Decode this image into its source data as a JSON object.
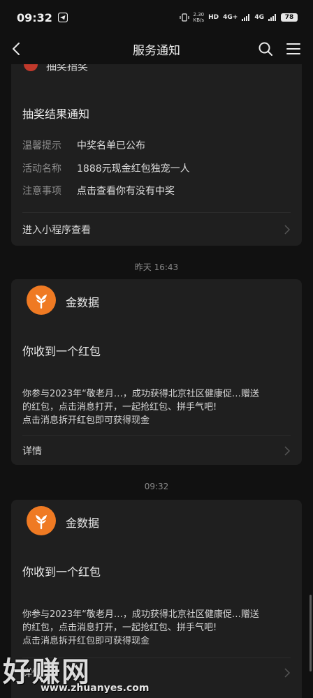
{
  "status_bar": {
    "time": "09:32",
    "speed_value": "2.30",
    "speed_unit": "KB/s",
    "hd": "HD",
    "net1": "4G+",
    "net2": "4G",
    "battery": "78"
  },
  "nav": {
    "title": "服务通知"
  },
  "card1": {
    "partial_name": "抽奖指奖",
    "title": "抽奖结果通知",
    "rows": [
      {
        "label": "温馨提示",
        "value": "中奖名单已公布"
      },
      {
        "label": "活动名称",
        "value": "1888元现金红包独宠一人"
      },
      {
        "label": "注意事项",
        "value": "点击查看你有没有中奖"
      }
    ],
    "footer": "进入小程序查看"
  },
  "time1": "昨天 16:43",
  "card2": {
    "brand": "金数据",
    "title": "你收到一个红包",
    "line1": "你参与2023年“敬老月…，成功获得北京社区健康促…赠送",
    "line2": "的红包，点击消息打开，一起抢红包、拼手气吧!",
    "line3": "点击消息拆开红包即可获得现金",
    "footer": "详情"
  },
  "time2": "09:32",
  "card3": {
    "brand": "金数据",
    "title": "你收到一个红包",
    "line1": "你参与2023年“敬老月…，成功获得北京社区健康促…赠送",
    "line2": "的红包，点击消息打开，一起抢红包、拼手气吧!",
    "line3": "点击消息拆开红包即可获得现金",
    "footer": "详情"
  },
  "watermark": {
    "big": "好赚网",
    "small": "www.zhuanyes.com"
  },
  "colors": {
    "background": "#111111",
    "card": "#1f1f1f",
    "brand_orange": "#ef7a23"
  }
}
